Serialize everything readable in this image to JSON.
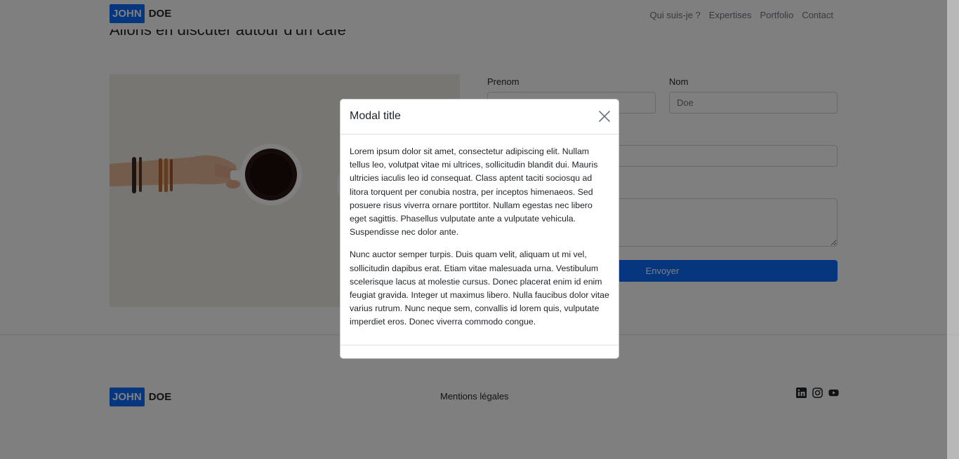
{
  "nav": {
    "logo_first": "JOHN",
    "logo_last": "DOE",
    "links": [
      "Qui suis-je ?",
      "Expertises",
      "Portfolio",
      "Contact"
    ]
  },
  "contact": {
    "title": "Allons en discuter autour d'un café",
    "prenom_label": "Prenom",
    "nom_label": "Nom",
    "nom_value": "Doe",
    "submit_label": "Envoyer"
  },
  "footer": {
    "logo_first": "JOHN",
    "logo_last": "DOE",
    "legal_link": "Mentions légales",
    "socials": [
      "linkedin-icon",
      "instagram-icon",
      "youtube-icon"
    ]
  },
  "modal": {
    "title": "Modal title",
    "paragraph_1": "Lorem ipsum dolor sit amet, consectetur adipiscing elit. Nullam tellus leo, volutpat vitae mi ultrices, sollicitudin blandit dui. Mauris ultricies iaculis leo id consequat. Class aptent taciti sociosqu ad litora torquent per conubia nostra, per inceptos himenaeos. Sed posuere risus viverra ornare porttitor. Nullam egestas nec libero eget sagittis. Phasellus vulputate ante a vulputate vehicula. Suspendisse nec dolor ante.",
    "paragraph_2": "Nunc auctor semper turpis. Duis quam velit, aliquam ut mi vel, sollicitudin dapibus erat. Etiam vitae malesuada urna. Vestibulum scelerisque lacus at molestie cursus. Donec placerat enim id enim feugiat gravida. Integer ut maximus libero. Nulla faucibus dolor vitae varius rutrum. Nunc neque sem, convallis id lorem quis, vulputate imperdiet eros. Donec viverra commodo congue."
  },
  "colors": {
    "brand": "#0d6efd",
    "backdrop": "rgba(0,0,0,0.5)"
  }
}
